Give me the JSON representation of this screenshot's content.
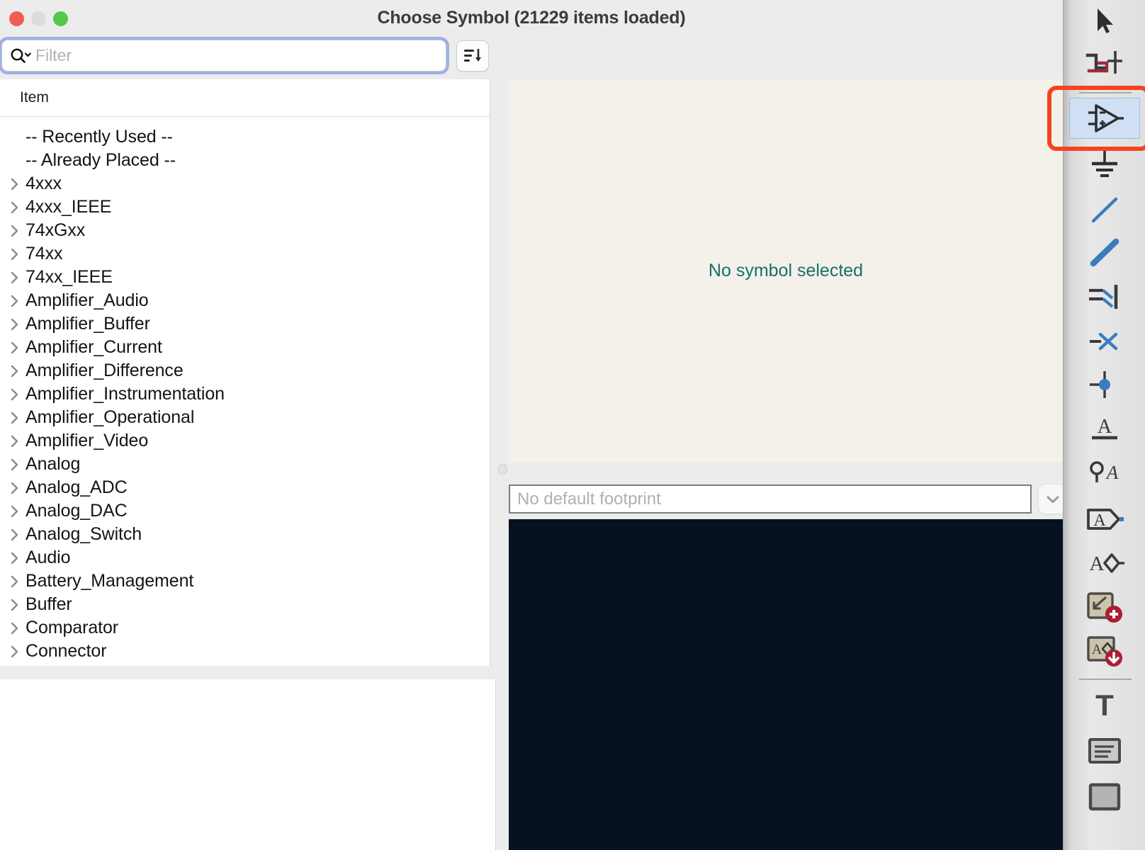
{
  "window": {
    "title": "Choose Symbol (21229 items loaded)",
    "traffic_lights": [
      {
        "name": "close",
        "color": "#f05c51"
      },
      {
        "name": "minimize",
        "color": "#dcdcdc"
      },
      {
        "name": "maximize",
        "color": "#55c74b"
      }
    ]
  },
  "filter": {
    "value": "",
    "placeholder": "Filter",
    "search_icon": "magnifier-with-chevron-icon",
    "sort_button": {
      "name": "sort-descending-icon",
      "tooltip": "Sort"
    }
  },
  "tree": {
    "column_header": "Item",
    "rows": [
      {
        "label": "-- Recently Used --",
        "expandable": false
      },
      {
        "label": "-- Already Placed --",
        "expandable": false
      },
      {
        "label": "4xxx",
        "expandable": true
      },
      {
        "label": "4xxx_IEEE",
        "expandable": true
      },
      {
        "label": "74xGxx",
        "expandable": true
      },
      {
        "label": "74xx",
        "expandable": true
      },
      {
        "label": "74xx_IEEE",
        "expandable": true
      },
      {
        "label": "Amplifier_Audio",
        "expandable": true
      },
      {
        "label": "Amplifier_Buffer",
        "expandable": true
      },
      {
        "label": "Amplifier_Current",
        "expandable": true
      },
      {
        "label": "Amplifier_Difference",
        "expandable": true
      },
      {
        "label": "Amplifier_Instrumentation",
        "expandable": true
      },
      {
        "label": "Amplifier_Operational",
        "expandable": true
      },
      {
        "label": "Amplifier_Video",
        "expandable": true
      },
      {
        "label": "Analog",
        "expandable": true
      },
      {
        "label": "Analog_ADC",
        "expandable": true
      },
      {
        "label": "Analog_DAC",
        "expandable": true
      },
      {
        "label": "Analog_Switch",
        "expandable": true
      },
      {
        "label": "Audio",
        "expandable": true
      },
      {
        "label": "Battery_Management",
        "expandable": true
      },
      {
        "label": "Buffer",
        "expandable": true
      },
      {
        "label": "Comparator",
        "expandable": true
      },
      {
        "label": "Connector",
        "expandable": true
      }
    ]
  },
  "preview": {
    "message": "No symbol selected",
    "message_color": "#1a6f6b",
    "background": "#f3f1ea"
  },
  "footprint": {
    "value": "",
    "placeholder": "No default footprint",
    "dropdown_icon": "chevron-down-icon"
  },
  "footprint_canvas": {
    "background": "#06121f"
  },
  "toolbar": {
    "accent_selected": "#cfe0f5",
    "annotation_color": "#f4441e",
    "tools": [
      {
        "name": "select-cursor-tool",
        "label": "Select",
        "selected": false,
        "separator_above": false
      },
      {
        "name": "add-net-class-directive-tool",
        "label": "Net class directive",
        "selected": false,
        "separator_above": false
      },
      {
        "name": "add-symbol-tool",
        "label": "Add symbol",
        "selected": true,
        "separator_above": true
      },
      {
        "name": "add-power-symbol-tool",
        "label": "Add power symbol",
        "selected": false,
        "separator_above": false
      },
      {
        "name": "draw-wire-tool",
        "label": "Draw wires",
        "selected": false,
        "separator_above": false
      },
      {
        "name": "draw-bus-tool",
        "label": "Draw buses",
        "selected": false,
        "separator_above": false
      },
      {
        "name": "add-bus-entry-tool",
        "label": "Add wire to bus entry",
        "selected": false,
        "separator_above": false
      },
      {
        "name": "add-no-connect-flag-tool",
        "label": "Add no connect flag",
        "selected": false,
        "separator_above": false
      },
      {
        "name": "add-junction-tool",
        "label": "Add junction",
        "selected": false,
        "separator_above": false
      },
      {
        "name": "add-net-label-tool",
        "label": "Add net label",
        "selected": false,
        "separator_above": false
      },
      {
        "name": "add-netclass-label-tool",
        "label": "Add netclass label",
        "selected": false,
        "separator_above": false
      },
      {
        "name": "add-global-label-tool",
        "label": "Add global label",
        "selected": false,
        "separator_above": false
      },
      {
        "name": "add-hierarchical-label-tool",
        "label": "Add hierarchical label",
        "selected": false,
        "separator_above": false
      },
      {
        "name": "add-hierarchical-sheet-tool",
        "label": "Add hierarchical sheet",
        "selected": false,
        "separator_above": false
      },
      {
        "name": "import-sheet-pin-tool",
        "label": "Import sheet pin",
        "selected": false,
        "separator_above": false
      },
      {
        "name": "add-text-tool",
        "label": "Add text",
        "selected": false,
        "separator_above": true
      },
      {
        "name": "add-text-box-tool",
        "label": "Add text box",
        "selected": false,
        "separator_above": false
      },
      {
        "name": "draw-rectangle-tool",
        "label": "Draw rectangle",
        "selected": false,
        "separator_above": false
      }
    ]
  }
}
